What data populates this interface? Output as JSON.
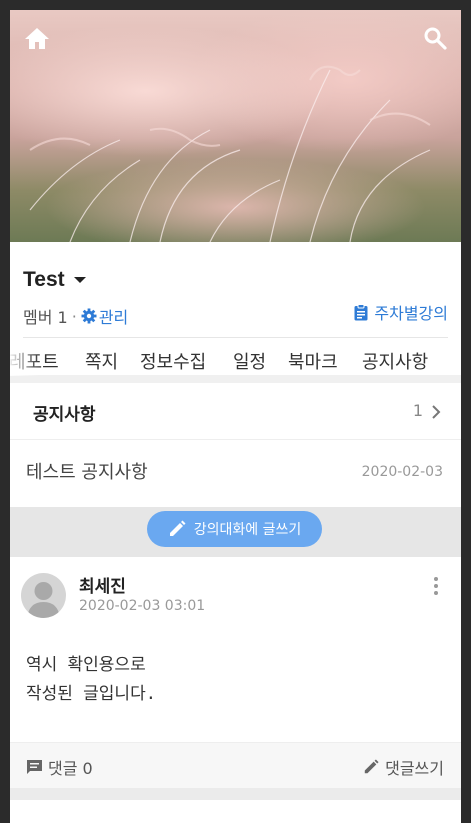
{
  "hero": {
    "home_icon": "home-icon",
    "search_icon": "search-icon"
  },
  "header": {
    "title": "Test",
    "member_label": "멤버 1",
    "separator": "·",
    "manage_label": "관리",
    "weekly_label": "주차별강의"
  },
  "tabs": [
    "레포트",
    "쪽지",
    "정보수집",
    "일정",
    "북마크",
    "공지사항"
  ],
  "notice": {
    "title": "공지사항",
    "count": "1",
    "item_title": "테스트 공지사항",
    "item_date": "2020-02-03"
  },
  "write_button": {
    "label": "강의대화에 글쓰기"
  },
  "post": {
    "author": "최세진",
    "datetime": "2020-02-03 03:01",
    "body_line1": "역시 확인용으로",
    "body_line2": "작성된 글입니다.",
    "comments_label": "댓글 0",
    "reply_label": "댓글쓰기"
  },
  "colors": {
    "accent": "#2e7bd6",
    "write_button": "#6aa8f0"
  }
}
